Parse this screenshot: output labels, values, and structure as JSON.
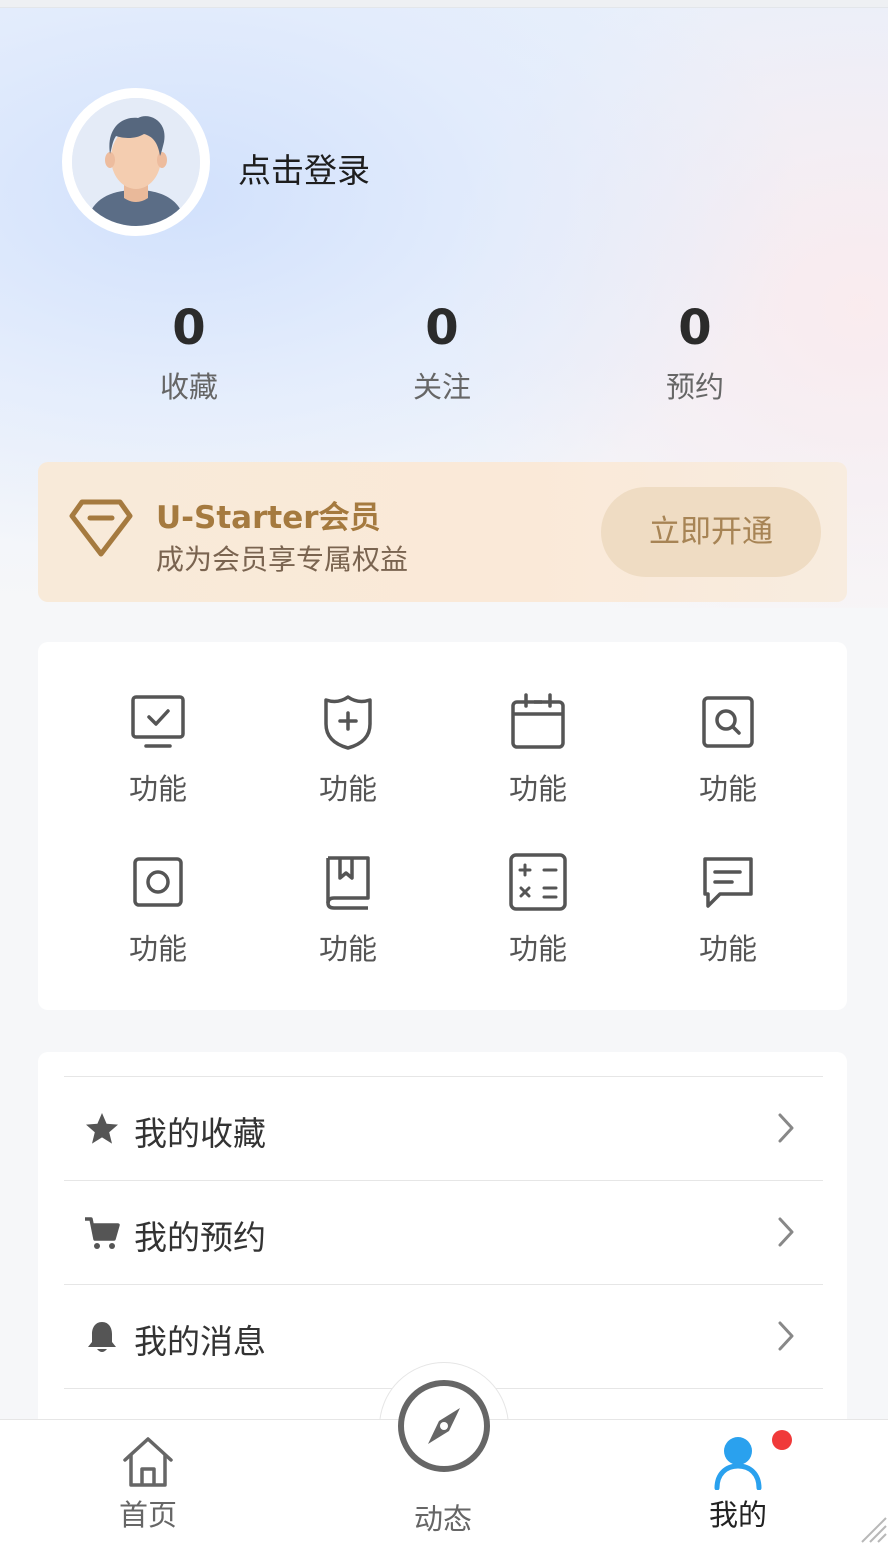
{
  "profile": {
    "login_text": "点击登录"
  },
  "stats": [
    {
      "value": "0",
      "label": "收藏"
    },
    {
      "value": "0",
      "label": "关注"
    },
    {
      "value": "0",
      "label": "预约"
    }
  ],
  "vip": {
    "icon": "diamond-icon",
    "title": "U-Starter会员",
    "subtitle": "成为会员享专属权益",
    "button_label": "立即开通",
    "accent_color": "#a57a3f"
  },
  "features": [
    {
      "icon": "monitor-check-icon",
      "label": "功能"
    },
    {
      "icon": "shield-plus-icon",
      "label": "功能"
    },
    {
      "icon": "calendar-icon",
      "label": "功能"
    },
    {
      "icon": "search-box-icon",
      "label": "功能"
    },
    {
      "icon": "camera-icon",
      "label": "功能"
    },
    {
      "icon": "book-icon",
      "label": "功能"
    },
    {
      "icon": "calculator-icon",
      "label": "功能"
    },
    {
      "icon": "message-icon",
      "label": "功能"
    }
  ],
  "menu": [
    {
      "icon": "star-icon",
      "label": "我的收藏"
    },
    {
      "icon": "cart-icon",
      "label": "我的预约"
    },
    {
      "icon": "bell-icon",
      "label": "我的消息"
    }
  ],
  "tabbar": {
    "items": [
      {
        "icon": "home-icon",
        "label": "首页"
      },
      {
        "icon": "compass-icon",
        "label": "动态"
      },
      {
        "icon": "user-icon",
        "label": "我的"
      }
    ],
    "active_color": "#2aa1ee",
    "badge_color": "#f03a3a"
  }
}
